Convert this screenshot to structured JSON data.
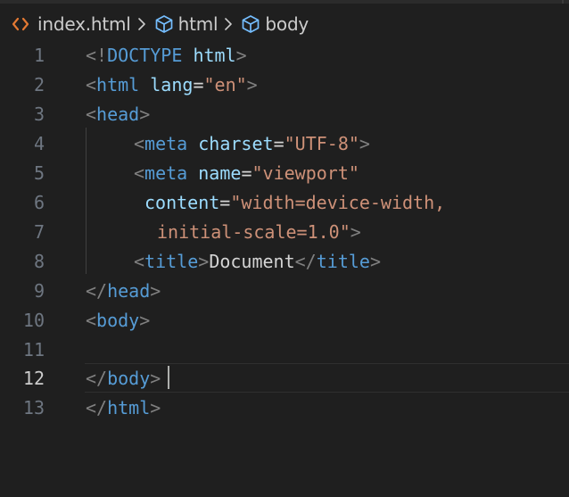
{
  "breadcrumb": {
    "file_icon": "html-file-icon",
    "file": "index.html",
    "items": [
      {
        "icon": "element-cube-icon",
        "label": "html"
      },
      {
        "icon": "element-cube-icon",
        "label": "body"
      }
    ]
  },
  "colors": {
    "background": "#1f1f1f",
    "tag": "#569cd6",
    "attribute": "#9cdcfe",
    "string": "#ce9178",
    "punctuation": "#808080",
    "text": "#d4d4d4",
    "line_number": "#6e7681",
    "line_number_active": "#cccccc",
    "file_icon": "#e37933"
  },
  "editor": {
    "current_line": 12,
    "lines": [
      {
        "number": "1"
      },
      {
        "number": "2"
      },
      {
        "number": "3"
      },
      {
        "number": "4"
      },
      {
        "number": "5"
      },
      {
        "number": "6"
      },
      {
        "number": "7"
      },
      {
        "number": "8"
      },
      {
        "number": "9"
      },
      {
        "number": "10"
      },
      {
        "number": "11"
      },
      {
        "number": "12"
      },
      {
        "number": "13"
      }
    ],
    "tokens": {
      "l1": [
        "<!",
        "DOCTYPE",
        " ",
        "html",
        ">"
      ],
      "l2": [
        "<",
        "html",
        " ",
        "lang",
        "=",
        "\"en\"",
        ">"
      ],
      "l3": [
        "<",
        "head",
        ">"
      ],
      "l4": [
        "<",
        "meta",
        " ",
        "charset",
        "=",
        "\"UTF-8\"",
        ">"
      ],
      "l5": [
        "<",
        "meta",
        " ",
        "name",
        "=",
        "\"viewport\""
      ],
      "l6": [
        "content",
        "=",
        "\"width=device-width,"
      ],
      "l7": [
        "initial-scale=1.0\"",
        ">"
      ],
      "l8": [
        "<",
        "title",
        ">",
        "Document",
        "</",
        "title",
        ">"
      ],
      "l9": [
        "</",
        "head",
        ">"
      ],
      "l10": [
        "<",
        "body",
        ">"
      ],
      "l12": [
        "</",
        "body",
        ">"
      ],
      "l13": [
        "</",
        "html",
        ">"
      ]
    }
  }
}
